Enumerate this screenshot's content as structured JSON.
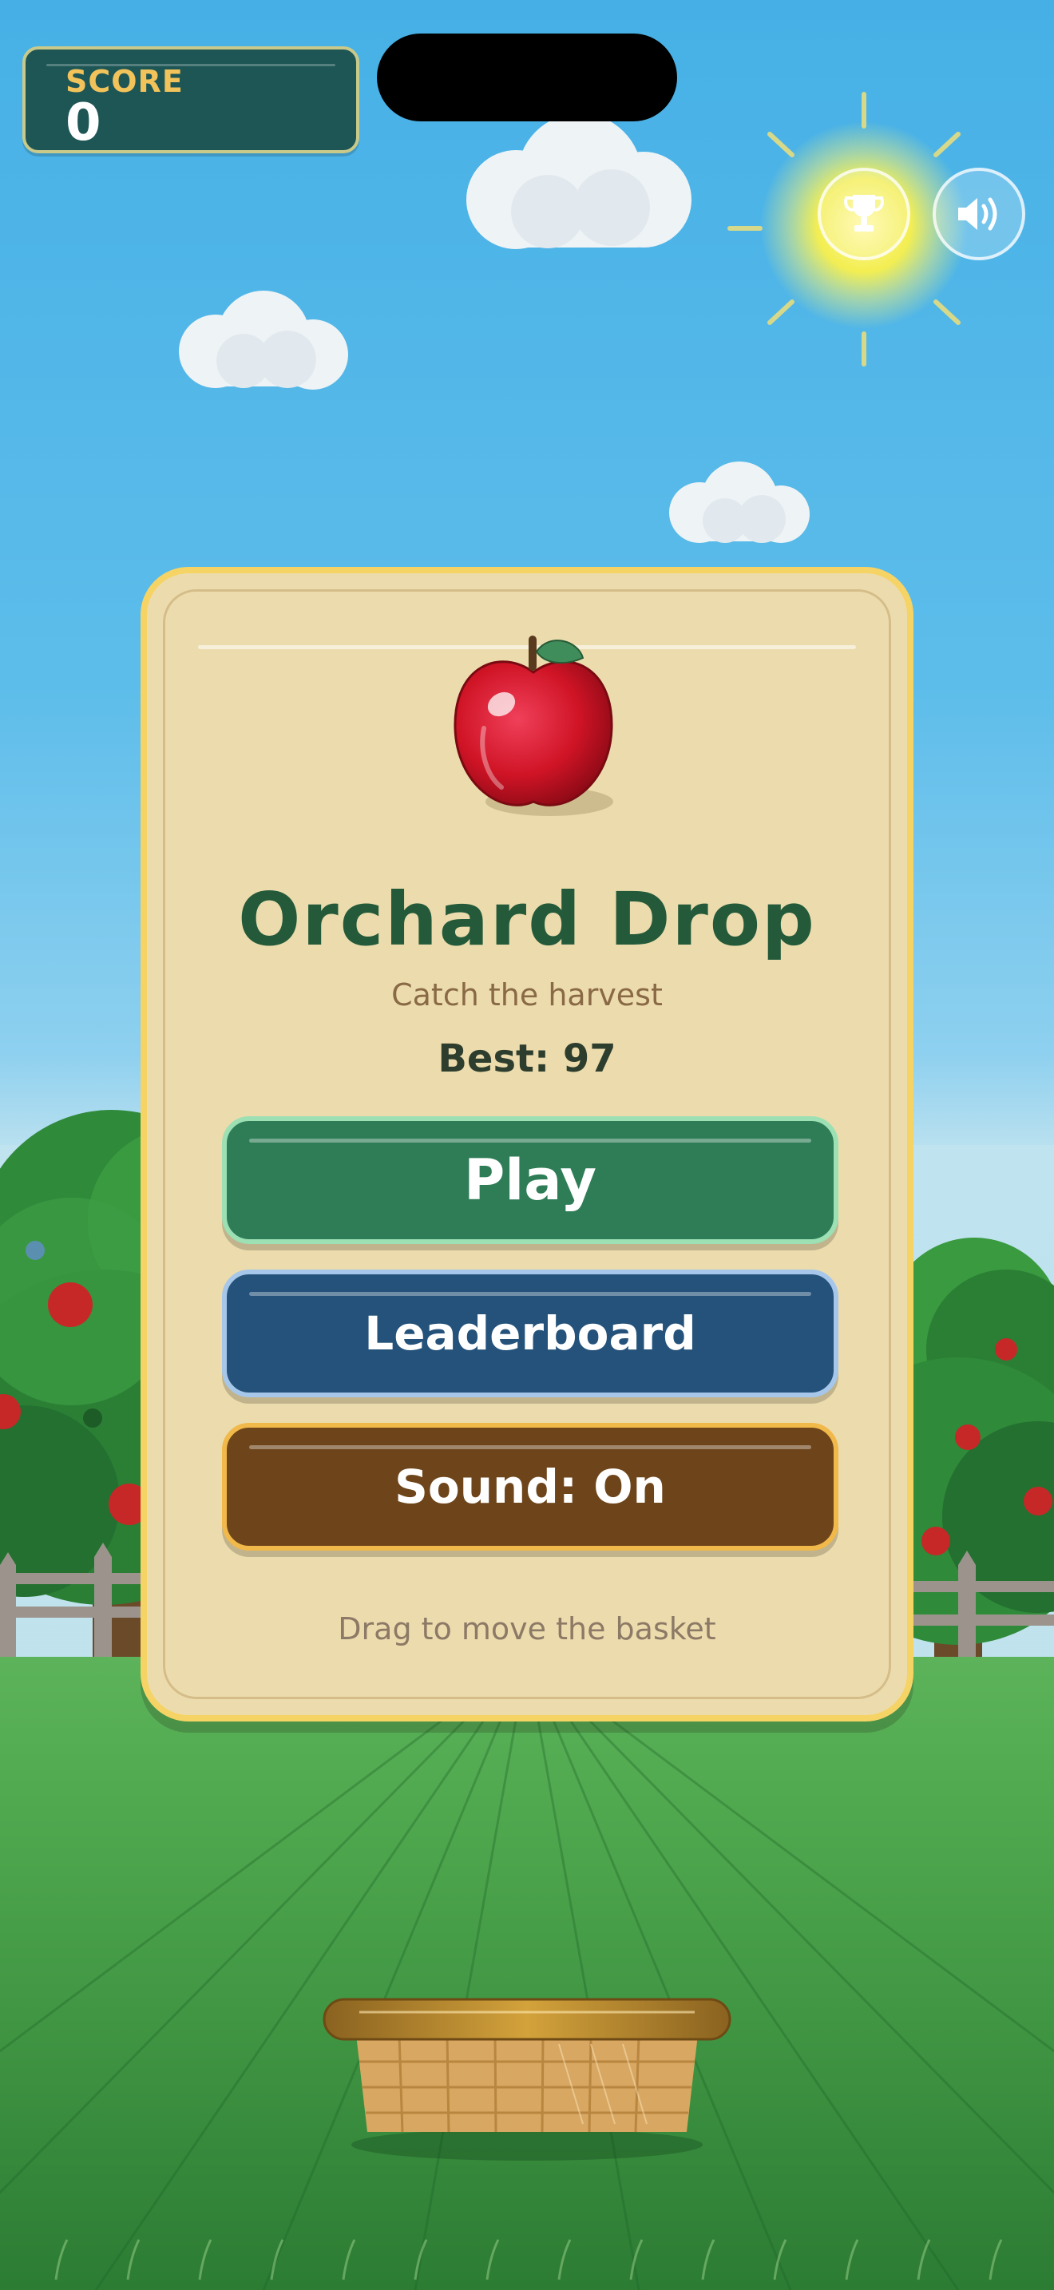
{
  "hud": {
    "score_label": "SCORE",
    "score_value": "0"
  },
  "icons": {
    "trophy": "trophy-icon",
    "sound": "speaker-icon",
    "apple": "apple-icon",
    "basket": "basket-icon"
  },
  "menu": {
    "title": "Orchard Drop",
    "subtitle": "Catch the harvest",
    "best": "Best: 97",
    "play_label": "Play",
    "leaderboard_label": "Leaderboard",
    "sound_label": "Sound: On",
    "hint": "Drag to move the basket"
  },
  "colors": {
    "sky": "#46b0e6",
    "grass": "#4fa84e",
    "card": "#ecdcad",
    "card_border": "#f6d365",
    "title": "#245a3a",
    "play": "#2e7d57",
    "leaderboard": "#24527a",
    "sound": "#6e451b"
  }
}
